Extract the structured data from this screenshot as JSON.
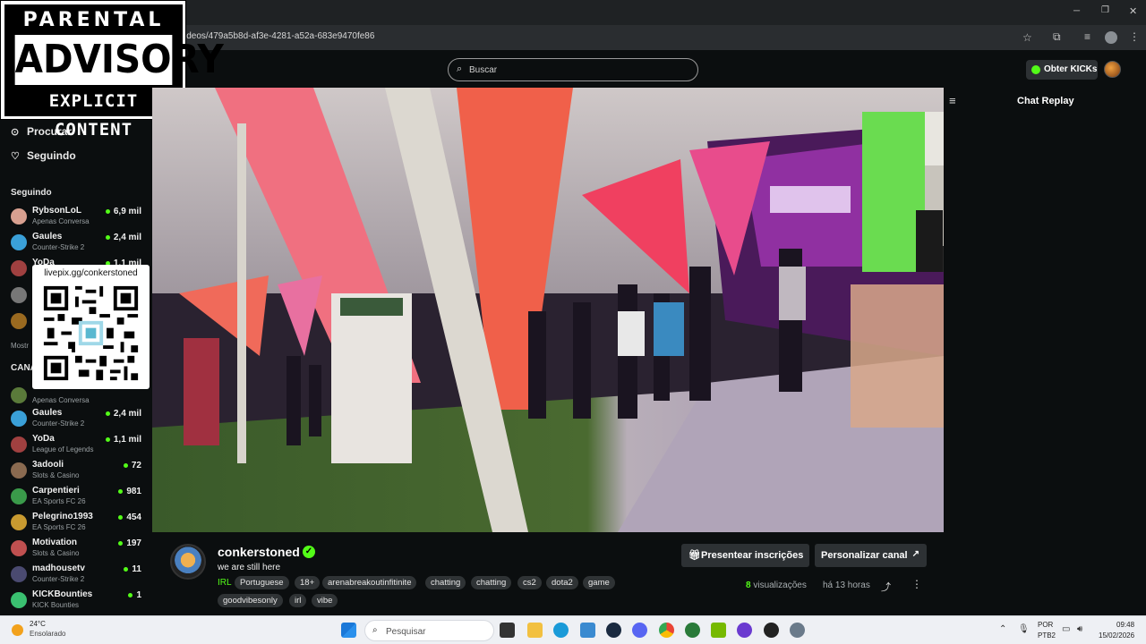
{
  "browser": {
    "url": "ideos/479a5b8d-af3e-4281-a52a-683e9470fe86"
  },
  "header": {
    "search_placeholder": "Buscar",
    "get_kicks_label": "Obter KICKs"
  },
  "parental_advisory": {
    "line1": "PARENTAL",
    "line2": "ADVISORY",
    "line3": "EXPLICIT CONTENT"
  },
  "sidebar": {
    "nav": [
      {
        "label": "Procurar",
        "icon": "compass-icon"
      },
      {
        "label": "Seguindo",
        "icon": "heart-icon"
      }
    ],
    "following_title": "Seguindo",
    "following": [
      {
        "name": "RybsonLoL",
        "category": "Apenas Conversa",
        "viewers": "6,9 mil",
        "color": "#d8a090"
      },
      {
        "name": "Gaules",
        "category": "Counter-Strike 2",
        "viewers": "2,4 mil",
        "color": "#3aa0d8"
      },
      {
        "name": "YoDa",
        "category": "",
        "viewers": "1,1 mil",
        "color": "#a04040"
      }
    ],
    "show_more_partial": "Mostr",
    "channels_title_partial": "CANA",
    "channels": [
      {
        "name": "",
        "category": "Apenas Conversa",
        "viewers": "",
        "color": "#5a7a3a"
      },
      {
        "name": "Gaules",
        "category": "Counter-Strike 2",
        "viewers": "2,4 mil",
        "color": "#3aa0d8"
      },
      {
        "name": "YoDa",
        "category": "League of Legends",
        "viewers": "1,1 mil",
        "color": "#a04040"
      },
      {
        "name": "3adooli",
        "category": "Slots & Casino",
        "viewers": "72",
        "color": "#8a6a50"
      },
      {
        "name": "Carpentieri",
        "category": "EA Sports FC 26",
        "viewers": "981",
        "color": "#3a9a4a"
      },
      {
        "name": "Pelegrino1993",
        "category": "EA Sports FC 26",
        "viewers": "454",
        "color": "#c89a30"
      },
      {
        "name": "Motivation",
        "category": "Slots & Casino",
        "viewers": "197",
        "color": "#c05050"
      },
      {
        "name": "madhousetv",
        "category": "Counter-Strike 2",
        "viewers": "11",
        "color": "#4a4a70"
      },
      {
        "name": "KICKBounties",
        "category": "KICK Bounties",
        "viewers": "1",
        "color": "#3ac070"
      }
    ],
    "qr_label": "livepix.gg/conkerstoned"
  },
  "chat": {
    "title": "Chat Replay"
  },
  "stream": {
    "streamer": "conkerstoned",
    "title": "we are still here",
    "category": "IRL",
    "tags": [
      "Portuguese",
      "18+",
      "arenabreakoutinfitinite",
      "chatting",
      "chatting",
      "cs2",
      "dota2",
      "game",
      "goodvibesonly",
      "irl",
      "vibe"
    ],
    "gift_label": "Presentear inscrições",
    "customize_label": "Personalizar canal",
    "views_count": "8",
    "views_label": " visualizações",
    "ago": "há 13 horas"
  },
  "taskbar": {
    "weather_temp": "24°C",
    "weather_desc": "Ensolarado",
    "search_label": "Pesquisar",
    "lang1": "POR",
    "lang2": "PTB2",
    "time": "09:48",
    "date": "15/02/2026"
  },
  "colors": {
    "accent": "#53fc18",
    "background": "#0b0e0f"
  }
}
